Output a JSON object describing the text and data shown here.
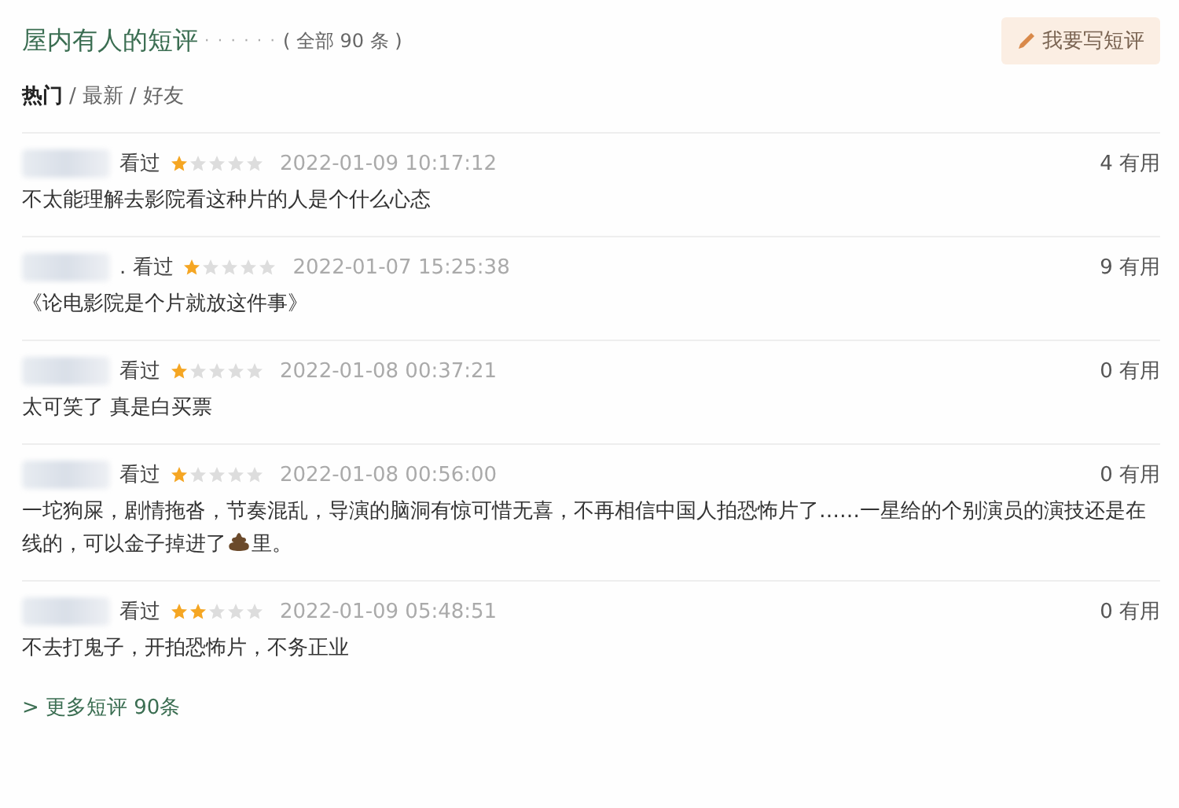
{
  "header": {
    "title": "屋内有人的短评",
    "dots": "· · · · · ·",
    "count": "( 全部 90 条 )",
    "write_button": "我要写短评"
  },
  "tab_separator": "/",
  "sort_tabs": [
    {
      "label": "热门",
      "selected": true
    },
    {
      "label": "最新",
      "selected": false
    },
    {
      "label": "好友",
      "selected": false
    }
  ],
  "reviews": [
    {
      "status": "看过",
      "stars": 1,
      "time": "2022-01-09 10:17:12",
      "votes": "4 有用",
      "comment": "不太能理解去影院看这种片的人是个什么心态"
    },
    {
      "status": ". 看过",
      "stars": 1,
      "time": "2022-01-07 15:25:38",
      "votes": "9 有用",
      "comment": "《论电影院是个片就放这件事》"
    },
    {
      "status": "看过",
      "stars": 1,
      "time": "2022-01-08 00:37:21",
      "votes": "0 有用",
      "comment": "太可笑了 真是白买票"
    },
    {
      "status": "看过",
      "stars": 1,
      "time": "2022-01-08 00:56:00",
      "votes": "0 有用",
      "comment": "一坨狗屎，剧情拖沓，节奏混乱，导演的脑洞有惊可惜无喜，不再相信中国人拍恐怖片了……一星给的个别演员的演技还是在线的，可以金子掉进了",
      "comment_after_icon": "里。"
    },
    {
      "status": "看过",
      "stars": 2,
      "time": "2022-01-09 05:48:51",
      "votes": "0 有用",
      "comment": "不去打鬼子，开拍恐怖片，不务正业"
    }
  ],
  "more_link": "> 更多短评 90条"
}
